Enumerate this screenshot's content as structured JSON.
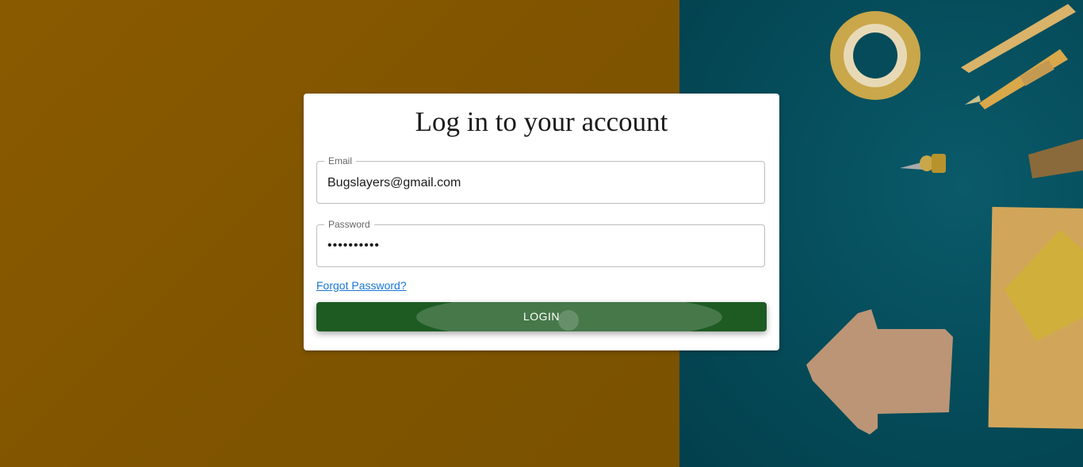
{
  "login": {
    "title": "Log in to your account",
    "email_label": "Email",
    "email_value": "Bugslayers@gmail.com",
    "password_label": "Password",
    "password_value": "••••••••••",
    "forgot_link": "Forgot Password?",
    "login_button": "LOGIN"
  },
  "colors": {
    "left_background": "#7f5400",
    "right_background": "#054b59",
    "button": "#1e5b23",
    "link": "#1976d2"
  }
}
